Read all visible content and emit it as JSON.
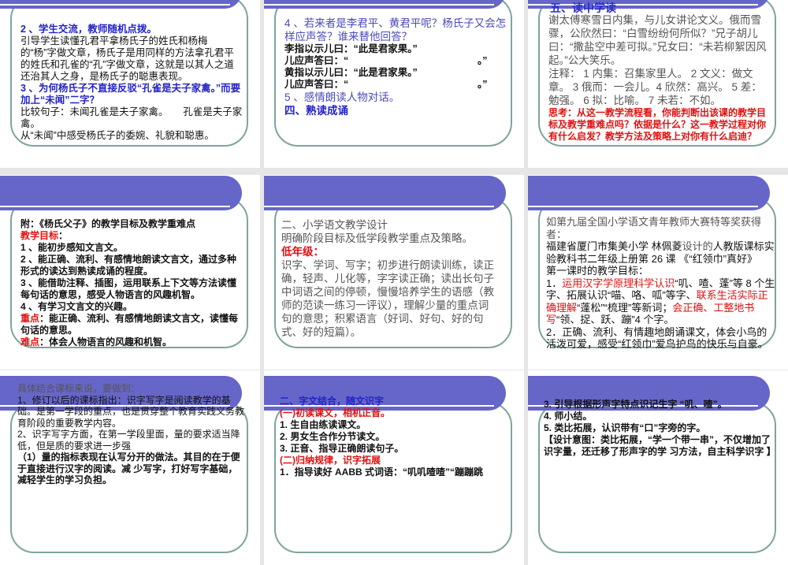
{
  "colors": {
    "banner": "#6666c8",
    "border": "#7ea49e",
    "blue": "#2323c8",
    "red": "#e01010",
    "gap": "#e6e6e6"
  },
  "slides": [
    {
      "lines": [
        "2 、学生交流，教师随机点拨。",
        "引导学生读懂孔君平拿杨氏子的姓氏和杨梅的“杨”字做文章，杨氏子是用同样的方法拿孔君平的姓氏和孔雀的“孔”字做文章，这就是以其人之道还治其人之身，是杨氏子的聪惠表现。",
        "3 、为何杨氏子不直接反驳“孔雀是夫子家禽。”而要加上“未闻”二字？",
        "比较句子：未闻孔雀是夫子家禽。　　孔雀是夫子家禽。",
        "从“未闻”中感受杨氏子的委婉、礼貌和聪惠。"
      ]
    },
    {
      "lines": [
        "4 、若来者是李君平、黄君平呢？杨氏子又会怎样应声答？谁来替他回答？",
        "李指以示儿曰：“此是君家果。”",
        "儿应声答曰：“",
        "。”",
        "黄指以示儿曰：“此是君家果。”",
        "儿应声答曰：“",
        "。”",
        "5 、感情朗读人物对话。",
        "四、熟读成诵"
      ]
    },
    {
      "title": "五、读中学读",
      "lines": [
        "谢太傅寒雪日内集，与儿女讲论文义。俄而雪骤，公欣然曰：“白雪纷纷何所似？”兄子胡儿曰：“撒盐空中差可拟。”兄女曰：“未若柳絮因风起。”公大笑乐。",
        "注释： 1 内集：召集家里人。 2 文义：做文章。 3 俄而：一会儿。4 欣然：高兴。 5 差：勉强。 6 拟：比喻。 7 未若：不如。",
        "思考：从这一教学流程看，你能判断出该课的教学目标及教学重难点吗？依据是什么？这一教学过程对你有什么启发？教学方法及策略上对你有什么启迪？"
      ]
    },
    {
      "lines": [
        "附：《杨氏父子》的教学目标及教学重难点",
        "教学目标",
        "：",
        "1 、能初步感知文言文。",
        "2 、能正确、流利、有感情地朗读文言文，通过多种形式的读达到熟读成诵的程度。",
        "3 、能借助注释、插图，运用联系上下文等方法读懂每句话的意思，感受人物语言的风趣机智。",
        "4 、有学习文言文的兴趣。",
        "重点",
        "：能正确、流利、有感情地朗读文言文，读懂每句话的意思。",
        "难点",
        "：体会人物语言的风趣和机智。"
      ]
    },
    {
      "lines": [
        "二、小学语文教学设计",
        "明确阶段目标及低学段教学重点及策略。",
        "低年级：",
        "识字、学词、写字；初步进行朗读训练，读正确，轻声、儿化等，字字读正确；读出长句子中词语之间的停顿，慢慢培养学生的语感（教师的范读一练习一评议），理解少量的重点词句的意思；积累语言（好词、好句、好的句式、好的短篇）。"
      ]
    },
    {
      "lines": [
        "如第九届全国小学语文青年教师大赛特等奖获得者：",
        "福建省厦门市集美小学 林佩菱",
        "设计的",
        "人教版课标实验教科书二年级上册第 26 课 《“红领巾”真好》",
        "第一课时的教学目标：",
        "1．",
        "运用汉字学原理科学认识",
        "“叽、喳、蓬”等 8 个生字、拓展认识“喵、咯、呱”等字、",
        "联系生活实际正确理解",
        "“蓬松”“梳理”等新词；",
        "会正确、工整地书写",
        "“领、捉、跃、蹦”4 个字。",
        "2．正确、流利、有情趣地朗诵课文，体会小鸟的活泼可爱，感受“红领巾”爱鸟护鸟的快乐与自豪。"
      ]
    },
    {
      "lines": [
        "具体结合课标来说，要做到：",
        "1、修订以后的课标指出：识字写字是阅读教学的基础。是第一学段的重点，也是贯穿整个教育实践义务教育阶段的重要教学内容。",
        "2、识字写字方面，在第一学段里面，量的要求适当降低，但是质的要求进一步强",
        "（1）量的指标表现在认写分开的做法。其目的在于便于直接进行汉字的阅读。减 少写字，打好写字基础，减轻学生的学习负担。"
      ]
    },
    {
      "lines": [
        "二、字文结合，随文识字",
        "(一)初读课文，相机正音。",
        "1. 生自由练读课文。",
        "2. 男女生合作分节读文。",
        "3. 正音、指导正确朗读句子。",
        "(二)归纳规律，识字拓展",
        "1．指导读好 AABB 式词语：“叽叽喳喳”“蹦蹦跳"
      ]
    },
    {
      "lines": [
        "3. 引导根据形声字特点识记生字 “叽、喳”。",
        "4. 师小结。",
        "5. 类比拓展，认识带有“口”字旁的字。",
        "【设计意图：类比拓展，“学一个带一串”，不仅增加了识字量，还迁移了形声字的学 习方法，自主科学识字 】"
      ]
    }
  ]
}
